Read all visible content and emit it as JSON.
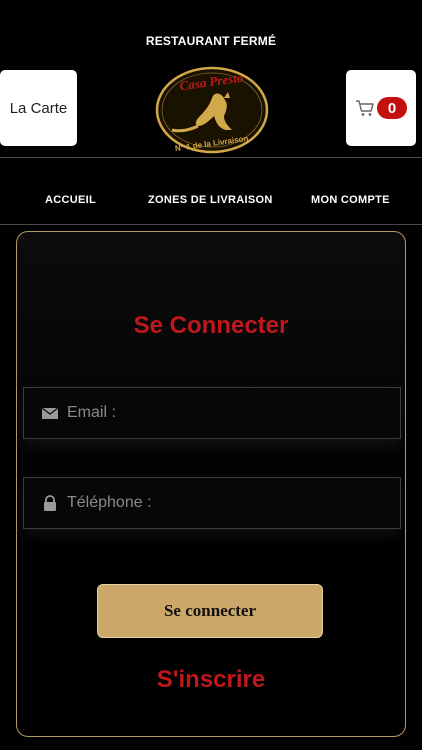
{
  "header": {
    "status": "RESTAURANT FERMÉ",
    "menu_button": "La Carte",
    "cart_count": "0",
    "logo": {
      "brand": "Casa Presto",
      "tagline": "N° 1 de la Livraison"
    }
  },
  "nav": {
    "items": [
      {
        "label": "ACCUEIL"
      },
      {
        "label": "ZONES DE LIVRAISON"
      },
      {
        "label": "MON COMPTE"
      }
    ]
  },
  "login": {
    "title": "Se Connecter",
    "email_placeholder": "Email :",
    "phone_placeholder": "Téléphone :",
    "submit": "Se connecter",
    "register": "S'inscrire"
  },
  "colors": {
    "accent_red": "#c0181a",
    "gold": "#cba86a",
    "card_border": "#b59a6a",
    "badge": "#c40f0f"
  }
}
